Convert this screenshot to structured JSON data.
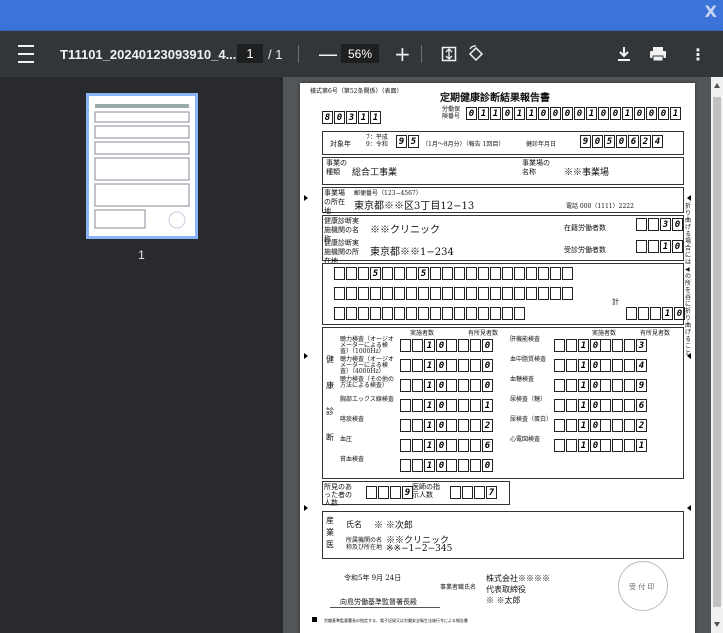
{
  "window": {
    "close_label": "X"
  },
  "toolbar": {
    "file_title": "T11101_20240123093910_4...",
    "page_current": "1",
    "page_total": "/ 1",
    "zoom_out_label": "—",
    "zoom": "56%",
    "zoom_in_label": "+"
  },
  "sidebar": {
    "thumb_number": "1"
  },
  "doc": {
    "form_no": "様式第6号（第52条関係）（表面）",
    "title": "定期健康診断結果報告書",
    "code_digits": [
      "8",
      "0",
      "3",
      "1",
      "1"
    ],
    "code_label": "労働保険番号",
    "insurance_digits": [
      "0",
      "1",
      "1",
      "0",
      "1",
      "1",
      "0",
      "0",
      "0",
      "0",
      "1",
      "0",
      "0",
      "1",
      "0",
      "0",
      "0",
      "1"
    ],
    "target_year_label": "対象年",
    "target_era": "7：平成 9：令和",
    "target_year_digits": [
      "9",
      "5"
    ],
    "target_period": "（1月～8月分）（報告 1回目）",
    "exam_date_label": "健診年月日",
    "exam_date_digits": [
      "9",
      "0",
      "5",
      "0",
      "6",
      "2",
      "4"
    ],
    "business_type_label": "事業の種類",
    "business_type": "総合工事業",
    "business_name_label": "事業場の名称",
    "business_name": "※※事業場",
    "address_label": "事業場の所在地",
    "postal": "郵便番号（123−4567）",
    "address": "東京都※※区3丁目12−13",
    "phone": "電話 000（1111）2222",
    "clinic_label": "健康診断実施機関の名称",
    "clinic_name": "※※クリニック",
    "workers_label": "在籍労働者数",
    "workers_digits": [
      "3",
      "0"
    ],
    "clinic_addr_label": "健康診断実施機関の所在地",
    "clinic_address": "東京都※※1−234",
    "examinees_label": "受診労働者数",
    "examinees_digits": [
      "1",
      "0"
    ],
    "row_a_digits": [
      "5",
      "5"
    ],
    "total_label": "計",
    "total_digits": [
      "1",
      "0"
    ],
    "exam_header_1": "実施者数",
    "exam_header_2": "有所見者数",
    "left_col_vertical": "健康診断",
    "tests_left": [
      {
        "label": "聴力検査（オージオメーターによる検査）（1000Hz）",
        "a": "10",
        "b": "0"
      },
      {
        "label": "聴力検査（オージオメーターによる検査）（4000Hz）",
        "a": "10",
        "b": "0"
      },
      {
        "label": "聴力検査（その他の方法による検査）",
        "a": "10",
        "b": "0"
      },
      {
        "label": "胸部エックス線検査",
        "a": "10",
        "b": "1"
      },
      {
        "label": "喀痰検査",
        "a": "10",
        "b": "2"
      },
      {
        "label": "血圧",
        "a": "10",
        "b": "6"
      },
      {
        "label": "貧血検査",
        "a": "10",
        "b": "0"
      }
    ],
    "tests_right": [
      {
        "label": "肝機能検査",
        "a": "10",
        "b": "3"
      },
      {
        "label": "血中脂質検査",
        "a": "10",
        "b": "4"
      },
      {
        "label": "血糖検査",
        "a": "10",
        "b": "9"
      },
      {
        "label": "尿検査（糖）",
        "a": "10",
        "b": "6"
      },
      {
        "label": "尿検査（蛋白）",
        "a": "10",
        "b": "2"
      },
      {
        "label": "心電図検査",
        "a": "10",
        "b": "1"
      }
    ],
    "findings_label": "所見のあった者の人数",
    "findings_value": "9",
    "doctor_instr_label": "医師の指示人数",
    "doctor_instr_value": "7",
    "doctor_section": "産業医",
    "doctor_name_label": "氏名",
    "doctor_name": "※ ※次郎",
    "doctor_org_label": "所属機関の名称及び所在地",
    "doctor_org": "※※クリニック",
    "doctor_org_addr": "※※−1−2−345",
    "report_date": "令和5年 9月 24日",
    "employer_label": "事業者職氏名",
    "company": "株式会社※※※※",
    "representative": "代表取締役",
    "rep_name": "※ ※太郎",
    "addressee": "向島労働基準監督署長殿",
    "stamp_label": "受 付 印",
    "side_note": "折り曲げる場合には◀の所を谷に折り曲げること",
    "footer_note": "労働基準監督署長の指定する、電子記録又は労働安全衛生法施行令による報告書"
  }
}
